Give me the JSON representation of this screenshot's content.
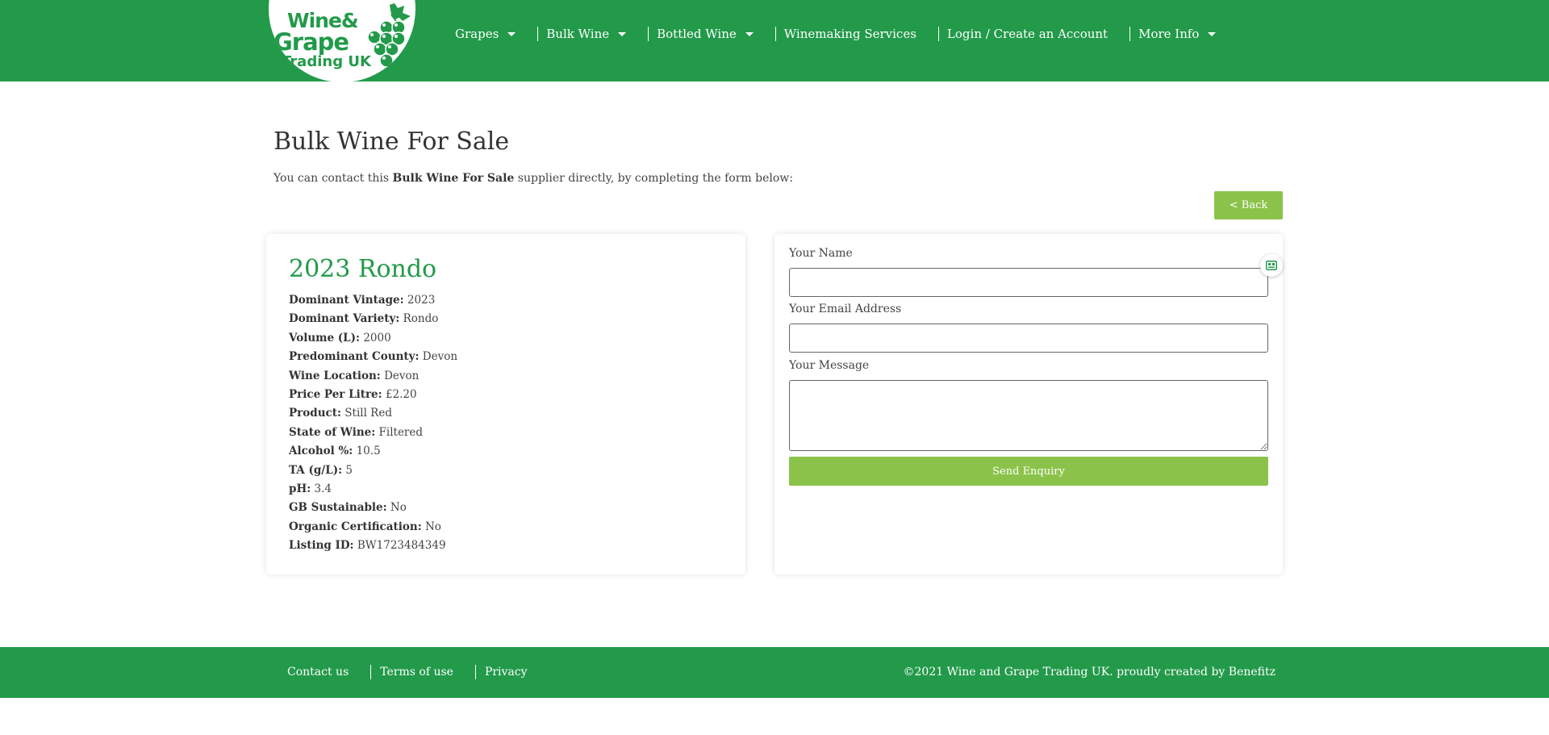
{
  "brand": {
    "logo_line1": "Wine&",
    "logo_line2": "Grape",
    "logo_line3": "Trading UK",
    "primary_color": "#229a4a",
    "accent_color": "#8bc34a"
  },
  "nav": {
    "items": [
      {
        "label": "Grapes",
        "has_dropdown": true
      },
      {
        "label": "Bulk Wine",
        "has_dropdown": true
      },
      {
        "label": "Bottled Wine",
        "has_dropdown": true
      },
      {
        "label": "Winemaking Services",
        "has_dropdown": false
      },
      {
        "label": "Login / Create an Account",
        "has_dropdown": false
      },
      {
        "label": "More Info",
        "has_dropdown": true
      }
    ]
  },
  "page": {
    "title": "Bulk Wine For Sale",
    "intro_before": "You can contact this ",
    "intro_bold": "Bulk Wine For Sale",
    "intro_after": " supplier directly, by completing the form below:",
    "back_label": "< Back"
  },
  "listing": {
    "title": "2023 Rondo",
    "details": [
      {
        "label": "Dominant Vintage:",
        "value": "2023"
      },
      {
        "label": "Dominant Variety:",
        "value": "Rondo"
      },
      {
        "label": "Volume (L):",
        "value": "2000"
      },
      {
        "label": "Predominant County:",
        "value": "Devon"
      },
      {
        "label": "Wine Location:",
        "value": "Devon"
      },
      {
        "label": "Price Per Litre:",
        "value": "£2.20"
      },
      {
        "label": "Product:",
        "value": "Still Red"
      },
      {
        "label": "State of Wine:",
        "value": "Filtered"
      },
      {
        "label": "Alcohol %:",
        "value": "10.5"
      },
      {
        "label": "TA (g/L):",
        "value": "5"
      },
      {
        "label": "pH:",
        "value": "3.4"
      },
      {
        "label": "GB Sustainable:",
        "value": "No"
      },
      {
        "label": "Organic Certification:",
        "value": "No"
      },
      {
        "label": "Listing ID:",
        "value": "BW1723484349"
      }
    ]
  },
  "form": {
    "name_label": "Your Name",
    "name_value": "",
    "email_label": "Your Email Address",
    "email_value": "",
    "message_label": "Your Message",
    "message_value": "",
    "submit_label": "Send Enquiry"
  },
  "footer": {
    "links": [
      "Contact us",
      "Terms of use",
      "Privacy"
    ],
    "copyright": "©2021 Wine and Grape Trading UK. proudly created by Benefitz"
  }
}
